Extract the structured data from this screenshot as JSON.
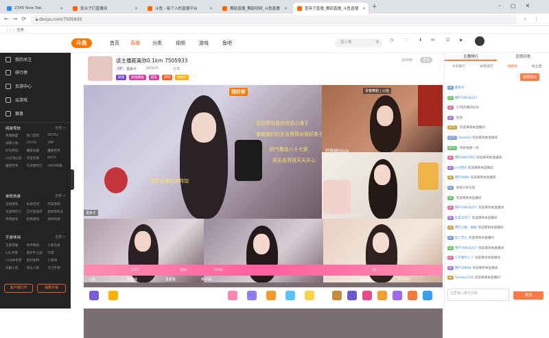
{
  "browser": {
    "tabs": [
      {
        "label": "2345 New Tab"
      },
      {
        "label": "复古子们直播间"
      },
      {
        "label": "斗鱼 - 每个人的直播平台"
      },
      {
        "label": "舞蹈直播_舞蹈视频_斗鱼直播"
      },
      {
        "label": "墨染子直播_舞蹈直播_斗鱼直播"
      }
    ],
    "url": "douyu.com/7505933",
    "bookmark": "应用"
  },
  "site": {
    "logo": "斗鱼",
    "nav": [
      "首页",
      "直播",
      "分类",
      "视频",
      "游戏",
      "鱼吧"
    ],
    "search_placeholder": "墨小唯",
    "icons": [
      "历史",
      "关注",
      "下载",
      "开播"
    ]
  },
  "sidebar": {
    "items": [
      "我的关注",
      "排行榜",
      "页游中心",
      "云游戏",
      "赛事"
    ],
    "sections": [
      {
        "title": "网游竞技",
        "more": "全部 >",
        "games": [
          "英雄联盟",
          "热门游戏",
          "DOTA2",
          "穿越火线",
          "CS:GO",
          "DNF",
          "炉石传说",
          "魔兽争霸",
          "魔兽世界",
          "lol云顶之弈",
          "守望先锋",
          "DOTA",
          "魔兽世界",
          "天涯明月刀",
          "APEX英雄"
        ]
      },
      {
        "title": "单机热游",
        "more": "全部 >",
        "games": [
          "主机游戏",
          "永劫无间",
          "怀旧游戏",
          "天涯明月刀",
          "艾尔登法环",
          "逃离塔科夫",
          "传奇游戏",
          "恐怖游戏",
          "单机热游"
        ]
      },
      {
        "title": "手游休闲",
        "more": "全部 >",
        "games": [
          "王者荣耀",
          "和平精英",
          "火影忍者",
          "LOL手游",
          "金铲铲之战",
          "幻塔",
          "CODM手游",
          "哈利波特",
          "小游戏",
          "穿越火线",
          "第五人格",
          "天刀手游"
        ]
      }
    ],
    "bottom_buttons": [
      "客户端打开",
      "我要开播"
    ]
  },
  "room": {
    "title": "该主播距离你0.1km 7505933",
    "streamer": "墨染子",
    "follow_count": "260925",
    "follow_label": "关注",
    "share_label": "分享",
    "tags": [
      "颜值",
      "颜值舞蹈",
      "甜美",
      "萝莉",
      "直播中"
    ],
    "overlay_badge": "墨染子",
    "user_id": "10208",
    "report_btn": "举报"
  },
  "video": {
    "danmaku": [
      "我好茶",
      "欢迎哥哥喜欢欢迎小潘子",
      "谢谢我们的无名哥哥对我好茶子",
      "欧气都去八十七家",
      "祝无名哥哥天天开心",
      "福建主播在波特加",
      "阿慧呐Silvia"
    ],
    "cell_names": [
      "墨染子",
      "阿慧呐",
      "墨素紫",
      "柳子嫣",
      "小倩",
      "Zhang",
      "墨染墨"
    ],
    "score_numbers": [
      "115",
      "360",
      "7016",
      "15"
    ],
    "banner": "青春舞蹈 | 火焰"
  },
  "chat": {
    "tabs": [
      "主播排行",
      "直播回看"
    ],
    "sub_tabs": [
      "今日排行",
      "本周排行",
      "贡献榜",
      "粉丝团"
    ],
    "fans_btn": "我要赞助",
    "lines": [
      {
        "lv": "LV",
        "name": "墨染子",
        "text": ""
      },
      {
        "lv": "LV",
        "name": "用户19910227",
        "text": ""
      },
      {
        "lv": "LV",
        "name": "",
        "text": "27年的我的618"
      },
      {
        "lv": "LV",
        "name": "",
        "text": "欢迎"
      },
      {
        "lv": "LV71",
        "name": "",
        "text": "欢迎来到本直播间"
      },
      {
        "lv": "LV71",
        "name": "Strati63",
        "text": "欢迎来到本直播间"
      },
      {
        "lv": "LV71",
        "name": "",
        "text": "有好福星一点"
      },
      {
        "lv": "LV",
        "name": "用户0897460",
        "text": "欢迎来到本直播间"
      },
      {
        "lv": "LV",
        "name": "ccd空间",
        "text": "欢迎来到本直播间"
      },
      {
        "lv": "LV",
        "name": "用户8888",
        "text": "欢迎来到本直播间"
      },
      {
        "lv": "LV",
        "name": "",
        "text": "给你三条信息"
      },
      {
        "lv": "LV",
        "name": "",
        "text": "欢迎来到本直播间"
      },
      {
        "lv": "LV",
        "name": "用户19910227",
        "text": "欢迎来到本直播间"
      },
      {
        "lv": "LV",
        "name": "红菜大作了",
        "text": "欢迎来到本直播间"
      },
      {
        "lv": "LV",
        "name": "用户之静 · 瓶瓶",
        "text": "欢迎来到本直播间"
      },
      {
        "lv": "LV",
        "name": "哲人无尘",
        "text": "欢迎来到本直播间"
      },
      {
        "lv": "LV",
        "name": "用户19910227",
        "text": "欢迎来到本直播间"
      },
      {
        "lv": "LV",
        "name": "小可爱叶心了",
        "text": "欢迎来到本直播间"
      },
      {
        "lv": "LV",
        "name": "用户28888",
        "text": "欢迎来到本直播间"
      },
      {
        "lv": "LV",
        "name": "Tumbler128",
        "text": "欢迎来到本直播间"
      }
    ],
    "input_placeholder": "这里输入聊天内容",
    "send_label": "发送"
  }
}
